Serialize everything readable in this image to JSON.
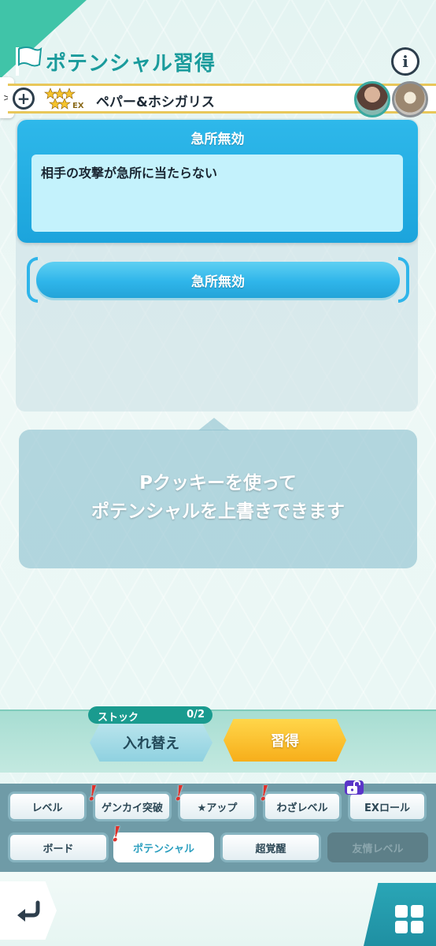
{
  "header": {
    "title": "ポテンシャル習得",
    "info_icon": "i"
  },
  "side_tab": {
    "label": ">"
  },
  "character": {
    "name": "ペパー&ホシガリス",
    "rarity_badge": "EX",
    "plus_icon": "+"
  },
  "skill": {
    "title": "急所無効",
    "description": "相手の攻撃が急所に当たらない",
    "slot_label": "急所無効"
  },
  "message": {
    "line1": "Pクッキーを使って",
    "line2": "ポテンシャルを上書きできます"
  },
  "actions": {
    "stock_label": "ストック",
    "stock_value": "0/2",
    "swap_label": "入れ替え",
    "learn_label": "習得"
  },
  "tabs": {
    "row1": [
      {
        "label": "レベル"
      },
      {
        "label": "ゲンカイ突破"
      },
      {
        "label": "★アップ"
      },
      {
        "label": "わざレベル"
      },
      {
        "label": "EXロール"
      }
    ],
    "row2": [
      {
        "label": "ボード"
      },
      {
        "label": "ポテンシャル"
      },
      {
        "label": "超覚醒"
      },
      {
        "label": "友情レベル"
      }
    ],
    "alert_mark": "!"
  },
  "colors": {
    "accent": "#1a9b9c",
    "skill_card": "#2eb8ea",
    "learn_button": "#f7ae1a"
  }
}
